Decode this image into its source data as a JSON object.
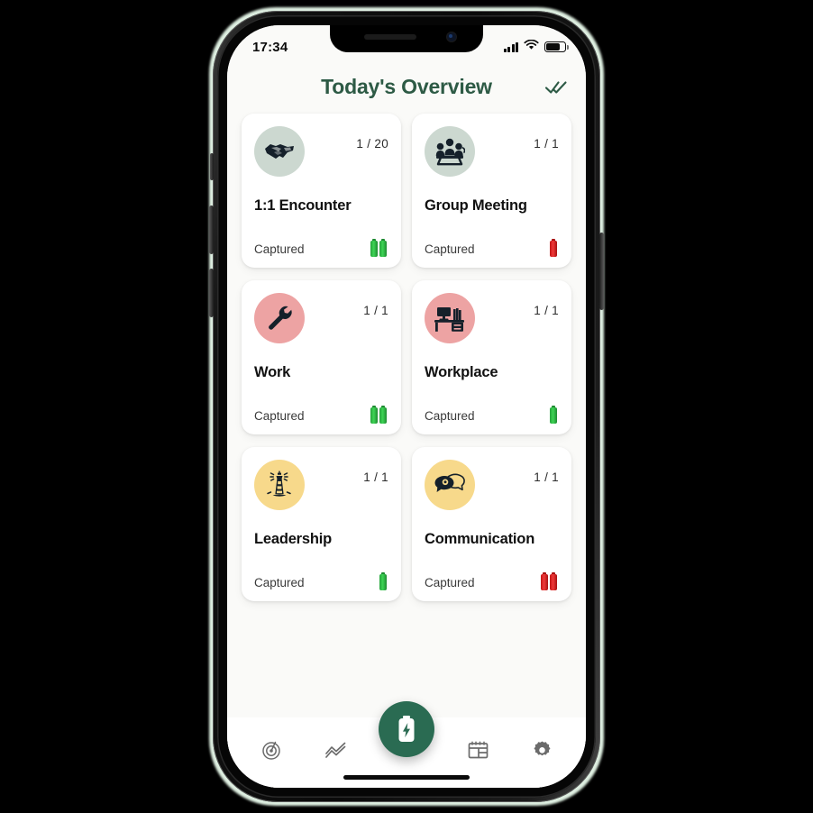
{
  "device": {
    "status_bar": {
      "time": "17:34",
      "cellular_icon": "cellular-bars-icon",
      "wifi_icon": "wifi-icon",
      "battery_icon": "battery-icon"
    }
  },
  "header": {
    "title": "Today's Overview",
    "action_icon": "double-check-icon",
    "title_color": "#2d5a45"
  },
  "cards": [
    {
      "title": "1:1 Encounter",
      "count": "1 / 20",
      "status": "Captured",
      "icon": "handshake-icon",
      "icon_bg": "#ccd8d0",
      "bars": 2,
      "bar_color": "green"
    },
    {
      "title": "Group Meeting",
      "count": "1 / 1",
      "status": "Captured",
      "icon": "group-meeting-icon",
      "icon_bg": "#ccd8d0",
      "bars": 1,
      "bar_color": "red"
    },
    {
      "title": "Work",
      "count": "1 / 1",
      "status": "Captured",
      "icon": "wrench-icon",
      "icon_bg": "#eda3a3",
      "bars": 2,
      "bar_color": "green"
    },
    {
      "title": "Workplace",
      "count": "1 / 1",
      "status": "Captured",
      "icon": "desk-icon",
      "icon_bg": "#eda3a3",
      "bars": 1,
      "bar_color": "green"
    },
    {
      "title": "Leadership",
      "count": "1 / 1",
      "status": "Captured",
      "icon": "lighthouse-icon",
      "icon_bg": "#f7d98b",
      "bars": 1,
      "bar_color": "green"
    },
    {
      "title": "Communication",
      "count": "1 / 1",
      "status": "Captured",
      "icon": "speech-bubbles-icon",
      "icon_bg": "#f7d98b",
      "bars": 2,
      "bar_color": "red"
    }
  ],
  "fab": {
    "icon": "battery-charging-icon",
    "color": "#2a6b52"
  },
  "bottom_nav": {
    "items": [
      {
        "icon": "radar-icon"
      },
      {
        "icon": "trending-chart-icon"
      },
      {
        "icon": "calendar-layout-icon"
      },
      {
        "icon": "gear-icon"
      }
    ]
  }
}
